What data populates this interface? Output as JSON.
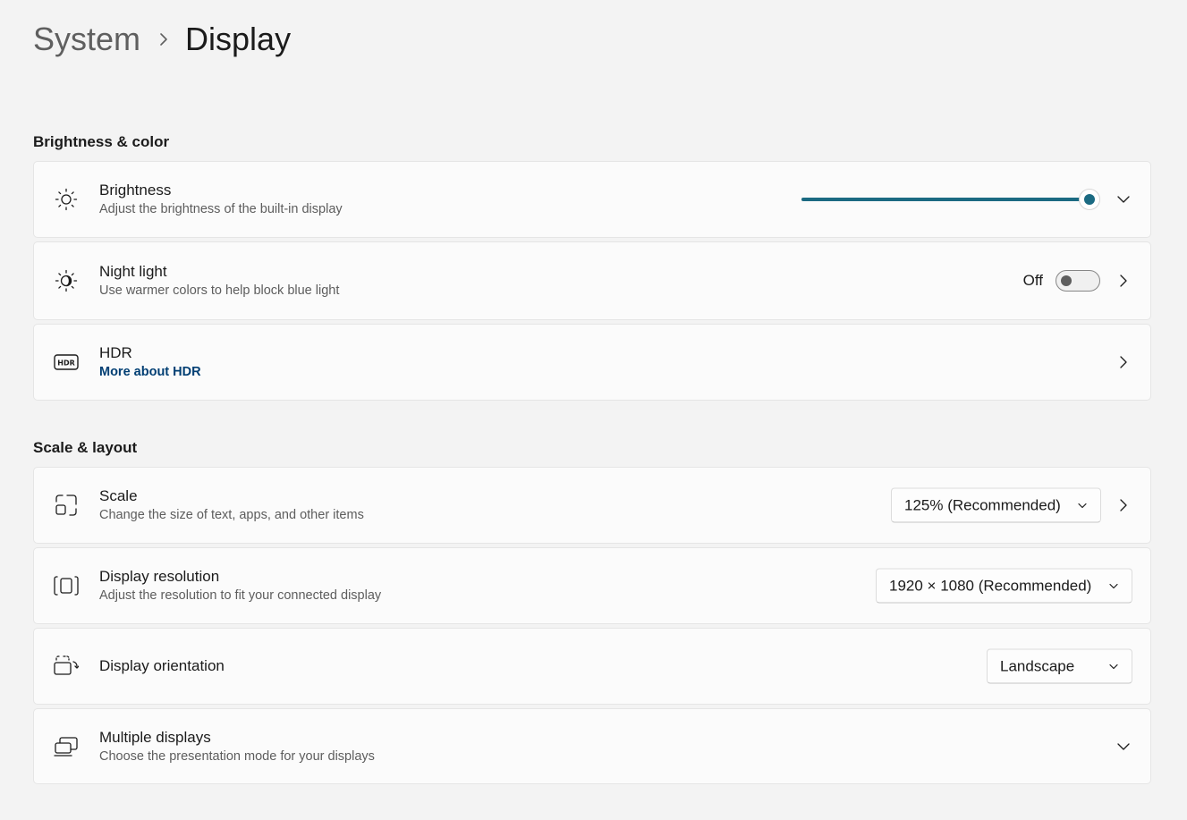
{
  "breadcrumb": {
    "parent": "System",
    "current": "Display"
  },
  "colors": {
    "accent": "#1b6a82",
    "link": "#003e73"
  },
  "sections": {
    "brightness_color": "Brightness & color",
    "scale_layout": "Scale & layout"
  },
  "brightness": {
    "title": "Brightness",
    "description": "Adjust the brightness of the built-in display",
    "value_percent": 100,
    "icon": "sun-icon"
  },
  "night_light": {
    "title": "Night light",
    "description": "Use warmer colors to help block blue light",
    "state_label": "Off",
    "enabled": false,
    "icon": "night-light-icon"
  },
  "hdr": {
    "title": "HDR",
    "link": "More about HDR",
    "icon": "hdr-icon"
  },
  "scale": {
    "title": "Scale",
    "description": "Change the size of text, apps, and other items",
    "selected": "125% (Recommended)",
    "icon": "scale-icon"
  },
  "resolution": {
    "title": "Display resolution",
    "description": "Adjust the resolution to fit your connected display",
    "selected": "1920 × 1080 (Recommended)",
    "icon": "resolution-icon"
  },
  "orientation": {
    "title": "Display orientation",
    "selected": "Landscape",
    "icon": "orientation-icon"
  },
  "multiple_displays": {
    "title": "Multiple displays",
    "description": "Choose the presentation mode for your displays",
    "icon": "multiple-displays-icon"
  }
}
